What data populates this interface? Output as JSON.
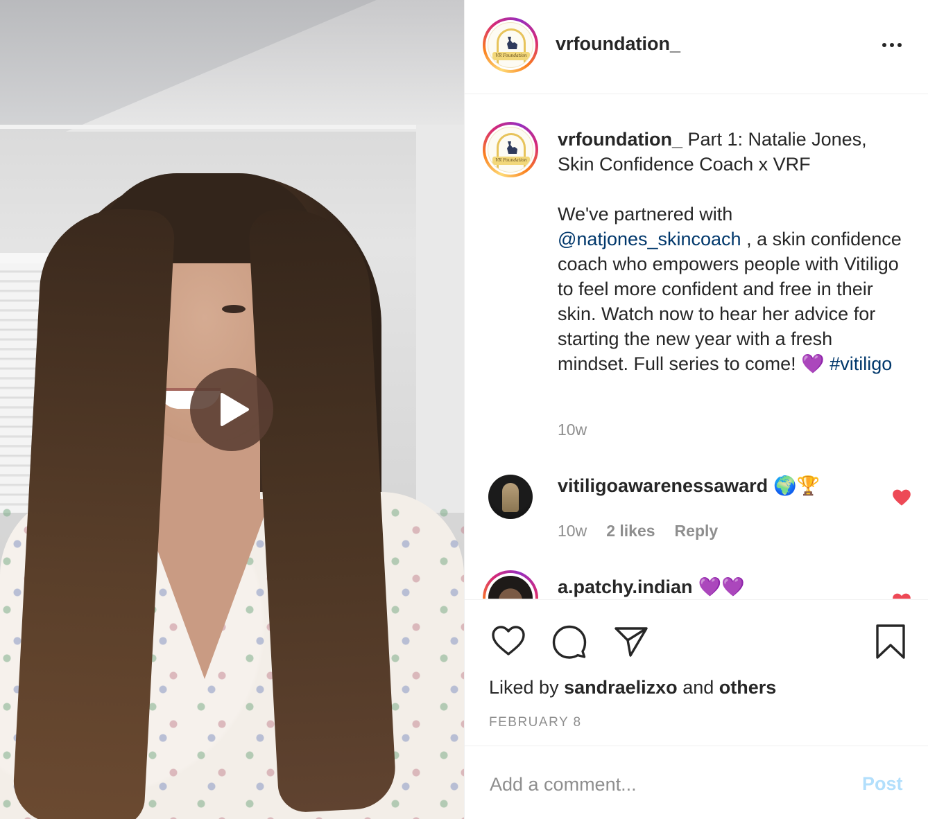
{
  "colors": {
    "link": "#00376b",
    "secondary_text": "#8e8e8e",
    "like_red": "#ed4956",
    "post_disabled": "#b2dffc",
    "play_overlay": "#5a3e32"
  },
  "media": {
    "type": "video",
    "play_icon": "play-icon"
  },
  "header": {
    "username": "vrfoundation_",
    "avatar_logo_text": "VR Foundation",
    "more_icon": "more-options-icon"
  },
  "caption": {
    "username": "vrfoundation_",
    "title": "Part 1: Natalie Jones, Skin Confidence Coach x VRF",
    "body_before_mention": "We've partnered with",
    "mention": "@natjones_skincoach",
    "body_after_mention": ", a skin confidence coach who empowers people with Vitiligo to feel more confident and free in their skin. Watch now to hear her advice for starting the new year with a fresh mindset. Full series to come!",
    "emoji": "💜",
    "hashtag": "#vitiligo",
    "time": "10w"
  },
  "comments": [
    {
      "username": "vitiligoawarenessaward",
      "emojis": "🌍🏆",
      "time": "10w",
      "likes": "2 likes",
      "reply": "Reply",
      "liked": true
    },
    {
      "username": "a.patchy.indian",
      "emojis": "💜💜",
      "liked": true
    }
  ],
  "actions": {
    "like_icon": "heart-icon",
    "comment_icon": "comment-icon",
    "share_icon": "share-icon",
    "save_icon": "bookmark-icon"
  },
  "likes": {
    "prefix": "Liked by",
    "user": "sandraelizxo",
    "conjunction": "and",
    "others": "others"
  },
  "date": "FEBRUARY 8",
  "add_comment": {
    "placeholder": "Add a comment...",
    "post_label": "Post"
  }
}
